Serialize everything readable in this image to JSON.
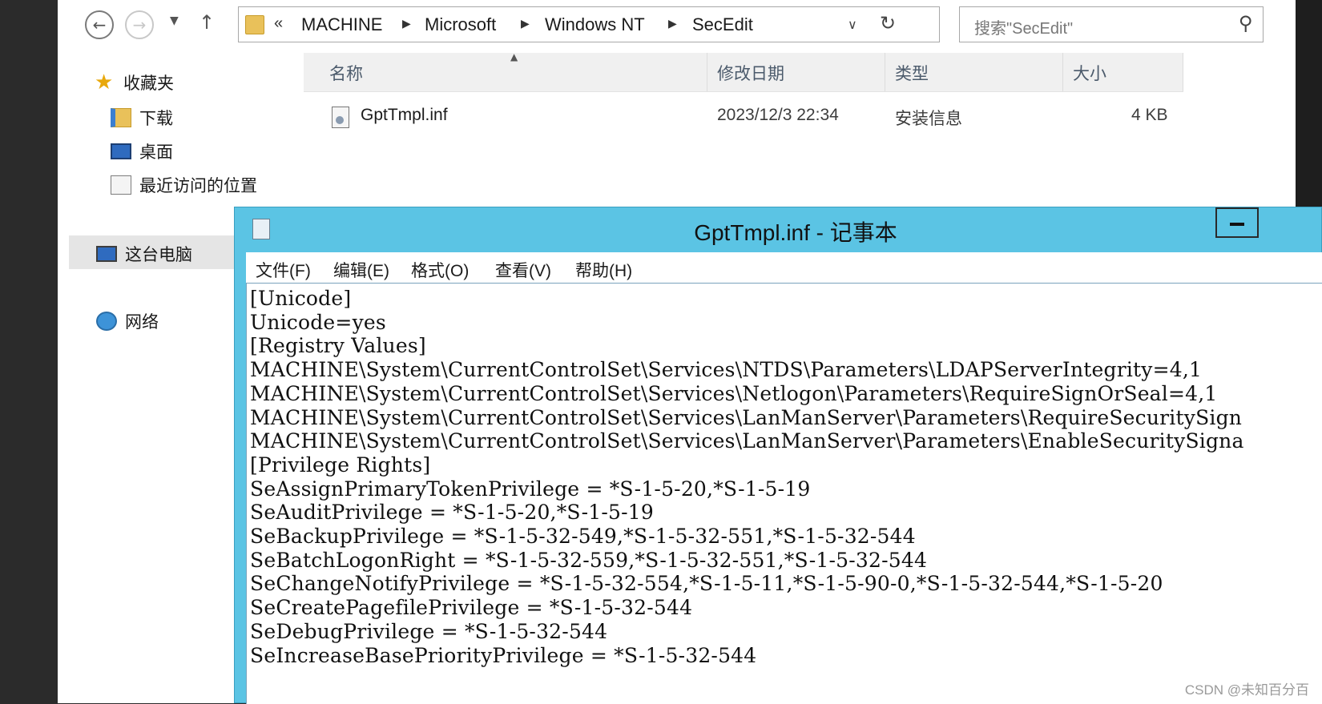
{
  "explorer": {
    "address": {
      "overflow": "«",
      "crumbs": [
        "MACHINE",
        "Microsoft",
        "Windows NT",
        "SecEdit"
      ]
    },
    "search": {
      "placeholder": "搜索\"SecEdit\""
    },
    "nav": {
      "favorites": "收藏夹",
      "downloads": "下载",
      "desktop": "桌面",
      "recent": "最近访问的位置",
      "this_pc": "这台电脑",
      "network": "网络"
    },
    "columns": {
      "name": "名称",
      "modified": "修改日期",
      "type": "类型",
      "size": "大小"
    },
    "files": [
      {
        "name": "GptTmpl.inf",
        "modified": "2023/12/3 22:34",
        "type": "安装信息",
        "size": "4 KB"
      }
    ]
  },
  "notepad": {
    "title": "GptTmpl.inf - 记事本",
    "menu": [
      "文件(F)",
      "编辑(E)",
      "格式(O)",
      "查看(V)",
      "帮助(H)"
    ],
    "lines": [
      "[Unicode]",
      "Unicode=yes",
      "[Registry Values]",
      "MACHINE\\System\\CurrentControlSet\\Services\\NTDS\\Parameters\\LDAPServerIntegrity=4,1",
      "MACHINE\\System\\CurrentControlSet\\Services\\Netlogon\\Parameters\\RequireSignOrSeal=4,1",
      "MACHINE\\System\\CurrentControlSet\\Services\\LanManServer\\Parameters\\RequireSecuritySign",
      "MACHINE\\System\\CurrentControlSet\\Services\\LanManServer\\Parameters\\EnableSecuritySigna",
      "[Privilege Rights]",
      "SeAssignPrimaryTokenPrivilege = *S-1-5-20,*S-1-5-19",
      "SeAuditPrivilege = *S-1-5-20,*S-1-5-19",
      "SeBackupPrivilege = *S-1-5-32-549,*S-1-5-32-551,*S-1-5-32-544",
      "SeBatchLogonRight = *S-1-5-32-559,*S-1-5-32-551,*S-1-5-32-544",
      "SeChangeNotifyPrivilege = *S-1-5-32-554,*S-1-5-11,*S-1-5-90-0,*S-1-5-32-544,*S-1-5-20",
      "SeCreatePagefilePrivilege = *S-1-5-32-544",
      "SeDebugPrivilege = *S-1-5-32-544",
      "SeIncreaseBasePriorityPrivilege = *S-1-5-32-544"
    ]
  },
  "watermark": "CSDN @未知百分百",
  "colors": {
    "notepad_frame": "#5bc4e4",
    "header_text": "#4b5a6b"
  }
}
